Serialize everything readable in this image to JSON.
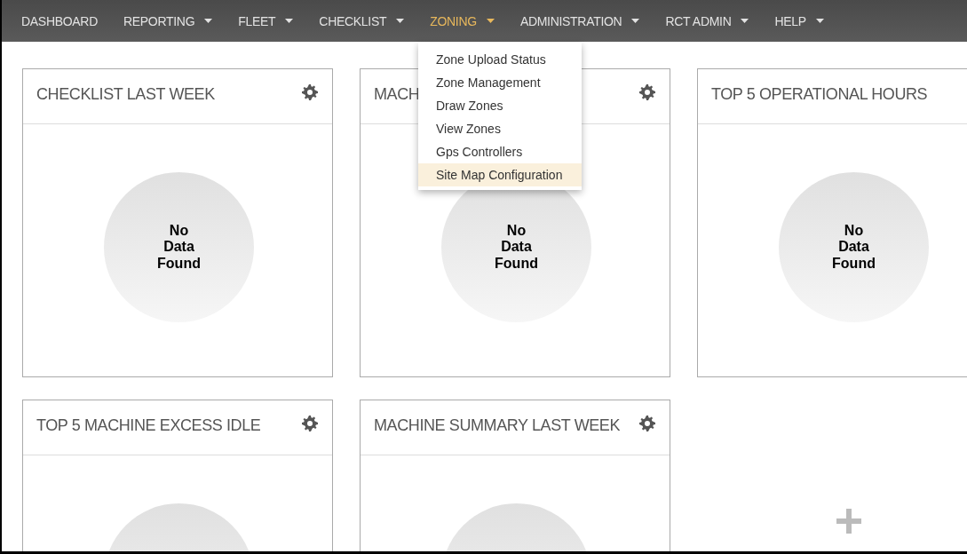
{
  "nav": [
    {
      "label": "DASHBOARD",
      "dropdown": false,
      "selected": false
    },
    {
      "label": "REPORTING",
      "dropdown": true,
      "selected": false
    },
    {
      "label": "FLEET",
      "dropdown": true,
      "selected": false
    },
    {
      "label": "CHECKLIST",
      "dropdown": true,
      "selected": false
    },
    {
      "label": "ZONING",
      "dropdown": true,
      "selected": true
    },
    {
      "label": "ADMINISTRATION",
      "dropdown": true,
      "selected": false
    },
    {
      "label": "RCT ADMIN",
      "dropdown": true,
      "selected": false
    },
    {
      "label": "HELP",
      "dropdown": true,
      "selected": false
    }
  ],
  "menu": [
    {
      "label": "Zone Upload Status",
      "selected": false
    },
    {
      "label": "Zone Management",
      "selected": false
    },
    {
      "label": "Draw Zones",
      "selected": false
    },
    {
      "label": "View Zones",
      "selected": false
    },
    {
      "label": "Gps Controllers",
      "selected": false
    },
    {
      "label": "Site Map Configuration",
      "selected": true
    }
  ],
  "cards": [
    {
      "kind": "chart",
      "title": "CHECKLIST LAST WEEK",
      "gear": true,
      "status": "No Data Found"
    },
    {
      "kind": "chart",
      "title": "MACH",
      "gear": true,
      "status": "No Data Found"
    },
    {
      "kind": "chart",
      "title": "TOP 5 OPERATIONAL HOURS",
      "gear": false,
      "status": "No Data Found"
    },
    {
      "kind": "chart",
      "title": "TOP 5 MACHINE EXCESS IDLE",
      "gear": true
    },
    {
      "kind": "chart",
      "title": "MACHINE SUMMARY LAST WEEK",
      "gear": true
    },
    {
      "kind": "add"
    }
  ]
}
